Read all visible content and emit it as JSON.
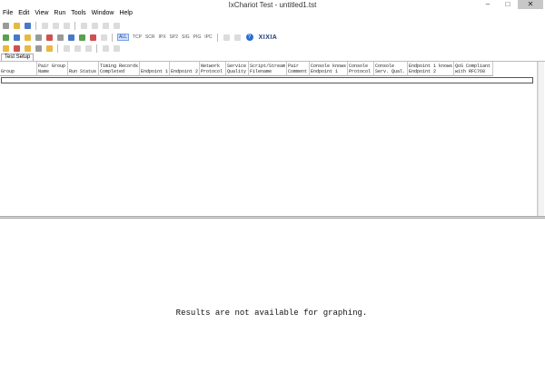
{
  "window": {
    "title": "IxChariot Test - untitled1.tst",
    "minimize": "–",
    "maximize": "□",
    "close": "✕"
  },
  "menu": [
    "File",
    "Edit",
    "View",
    "Run",
    "Tools",
    "Window",
    "Help"
  ],
  "toolbar": {
    "protocols": [
      "ALL",
      "TCP",
      "SCR",
      "IPX",
      "SP2",
      "SIG",
      "PIG",
      "IPC"
    ],
    "help_icon": "?",
    "logo": "XIXIA"
  },
  "tabs": [
    "Test Setup"
  ],
  "grid": {
    "columns": [
      "Group",
      "Pair Group Name",
      "Run Status",
      "Timing Records Completed",
      "Endpoint 1",
      "Endpoint 2",
      "Network Protocol",
      "Service Quality",
      "Script/Stream Filename",
      "Pair Comment",
      "Console knows Endpoint 1",
      "Console Protocol",
      "Console Serv. Qual.",
      "Endpoint 1 knows Endpoint 2",
      "QoS Compliant with RFC768"
    ]
  },
  "results_message": "Results are not available for graphing."
}
